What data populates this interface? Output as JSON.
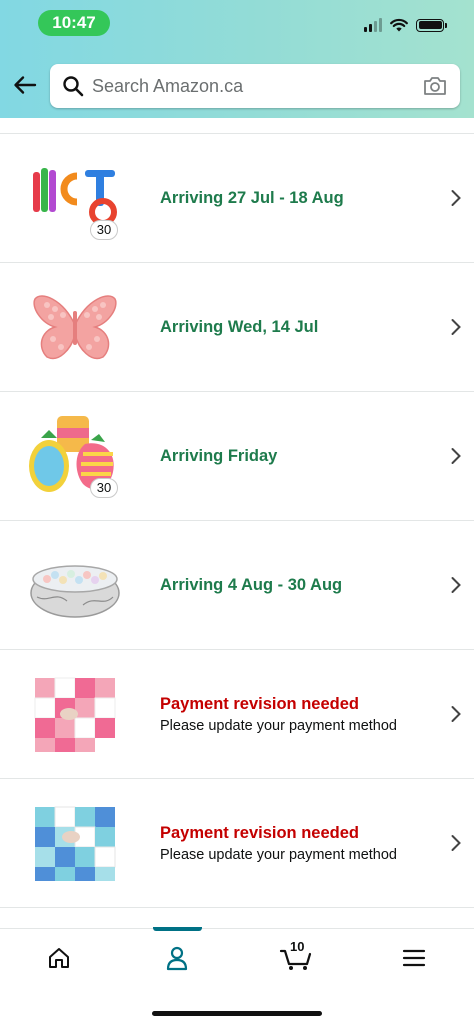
{
  "status_bar": {
    "time": "10:47"
  },
  "header": {
    "back_icon": "arrow-left-icon",
    "search": {
      "placeholder": "Search Amazon.ca",
      "value": ""
    },
    "camera_icon": "camera-icon"
  },
  "orders": [
    {
      "status": "Arriving 27 Jul - 18 Aug",
      "status_color": "#1e7b4c",
      "quantity": "30",
      "thumbnail": "pop-tubes"
    },
    {
      "status": "Arriving Wed, 14 Jul",
      "status_color": "#1e7b4c",
      "thumbnail": "butterfly-pop-it"
    },
    {
      "status": "Arriving Friday",
      "status_color": "#1e7b4c",
      "quantity": "30",
      "thumbnail": "fruit-pop-its"
    },
    {
      "status": "Arriving 4 Aug - 30 Aug",
      "status_color": "#1e7b4c",
      "thumbnail": "ball-pit"
    },
    {
      "status": "Payment revision needed",
      "status_color": "#c40000",
      "detail": "Please update your payment method",
      "thumbnail": "pink-foam-mat"
    },
    {
      "status": "Payment revision needed",
      "status_color": "#c40000",
      "detail": "Please update your payment method",
      "thumbnail": "blue-foam-mat"
    }
  ],
  "bottom_nav": {
    "items": [
      {
        "icon": "home-icon"
      },
      {
        "icon": "account-icon",
        "active": true
      },
      {
        "icon": "cart-icon",
        "count": "10"
      },
      {
        "icon": "menu-icon"
      }
    ],
    "accent_color": "#007185"
  }
}
